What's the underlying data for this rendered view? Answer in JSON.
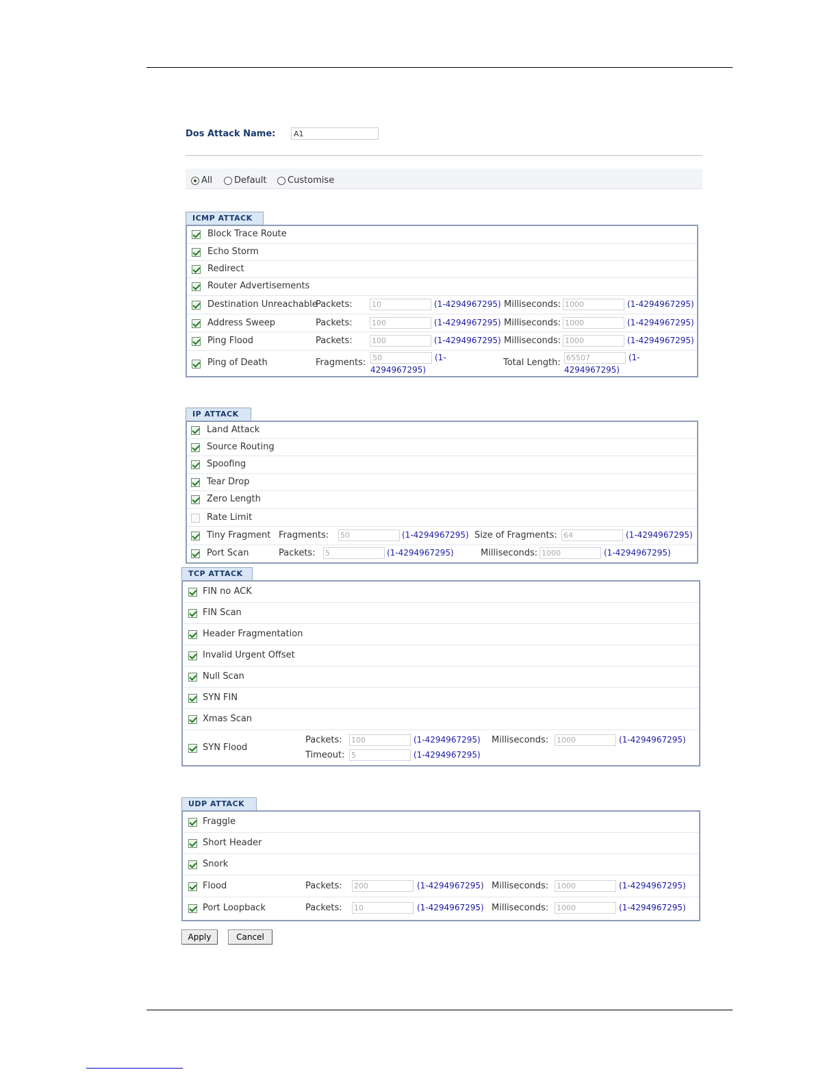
{
  "dos_attack_name": {
    "label": "Dos Attack Name:",
    "value": "A1"
  },
  "mode": {
    "options": [
      "All",
      "Default",
      "Customise"
    ],
    "selected": "All"
  },
  "range_text": "(1-4294967295)",
  "icmp": {
    "title": "ICMP ATTACK",
    "items": [
      {
        "label": "Block Trace Route",
        "checked": true
      },
      {
        "label": "Echo Storm",
        "checked": true
      },
      {
        "label": "Redirect",
        "checked": true
      },
      {
        "label": "Router Advertisements",
        "checked": true
      },
      {
        "label": "Destination Unreachable",
        "checked": true,
        "p1_label": "Packets:",
        "p1_value": "10",
        "p2_label": "Milliseconds:",
        "p2_value": "1000"
      },
      {
        "label": "Address Sweep",
        "checked": true,
        "p1_label": "Packets:",
        "p1_value": "100",
        "p2_label": "Milliseconds:",
        "p2_value": "1000"
      },
      {
        "label": "Ping Flood",
        "checked": true,
        "p1_label": "Packets:",
        "p1_value": "100",
        "p2_label": "Milliseconds:",
        "p2_value": "1000"
      },
      {
        "label": "Ping of Death",
        "checked": true,
        "p1_label": "Fragments:",
        "p1_value": "50",
        "p2_label": "Total Length:",
        "p2_value": "65507",
        "range_a": "(1-",
        "range_b": "4294967295)"
      }
    ]
  },
  "ip": {
    "title": "IP ATTACK",
    "items": [
      {
        "label": "Land Attack",
        "checked": true
      },
      {
        "label": "Source Routing",
        "checked": true
      },
      {
        "label": "Spoofing",
        "checked": true
      },
      {
        "label": "Tear Drop",
        "checked": true
      },
      {
        "label": "Zero Length",
        "checked": true
      },
      {
        "label": "Rate Limit",
        "checked": false
      },
      {
        "label": "Tiny Fragment",
        "checked": true,
        "p1_label": "Fragments:",
        "p1_value": "50",
        "p2_label": "Size of Fragments:",
        "p2_value": "64"
      },
      {
        "label": "Port Scan",
        "checked": true,
        "p1_label": "Packets:",
        "p1_value": "5",
        "p2_label": "Milliseconds:",
        "p2_value": "1000"
      }
    ]
  },
  "tcp": {
    "title": "TCP ATTACK",
    "items": [
      {
        "label": "FIN no ACK",
        "checked": true
      },
      {
        "label": "FIN Scan",
        "checked": true
      },
      {
        "label": "Header Fragmentation",
        "checked": true
      },
      {
        "label": "Invalid Urgent Offset",
        "checked": true
      },
      {
        "label": "Null Scan",
        "checked": true
      },
      {
        "label": "SYN FIN",
        "checked": true
      },
      {
        "label": "Xmas Scan",
        "checked": true
      },
      {
        "label": "SYN Flood",
        "checked": true,
        "p1_label": "Packets:",
        "p1_value": "100",
        "p2_label": "Milliseconds:",
        "p2_value": "1000",
        "p3_label": "Timeout:",
        "p3_value": "5"
      }
    ]
  },
  "udp": {
    "title": "UDP ATTACK",
    "items": [
      {
        "label": "Fraggle",
        "checked": true
      },
      {
        "label": "Short Header",
        "checked": true
      },
      {
        "label": "Snork",
        "checked": true
      },
      {
        "label": "Flood",
        "checked": true,
        "p1_label": "Packets:",
        "p1_value": "200",
        "p2_label": "Milliseconds:",
        "p2_value": "1000"
      },
      {
        "label": "Port Loopback",
        "checked": true,
        "p1_label": "Packets:",
        "p1_value": "10",
        "p2_label": "Milliseconds:",
        "p2_value": "1000"
      }
    ]
  },
  "buttons": {
    "apply": "Apply",
    "cancel": "Cancel"
  }
}
